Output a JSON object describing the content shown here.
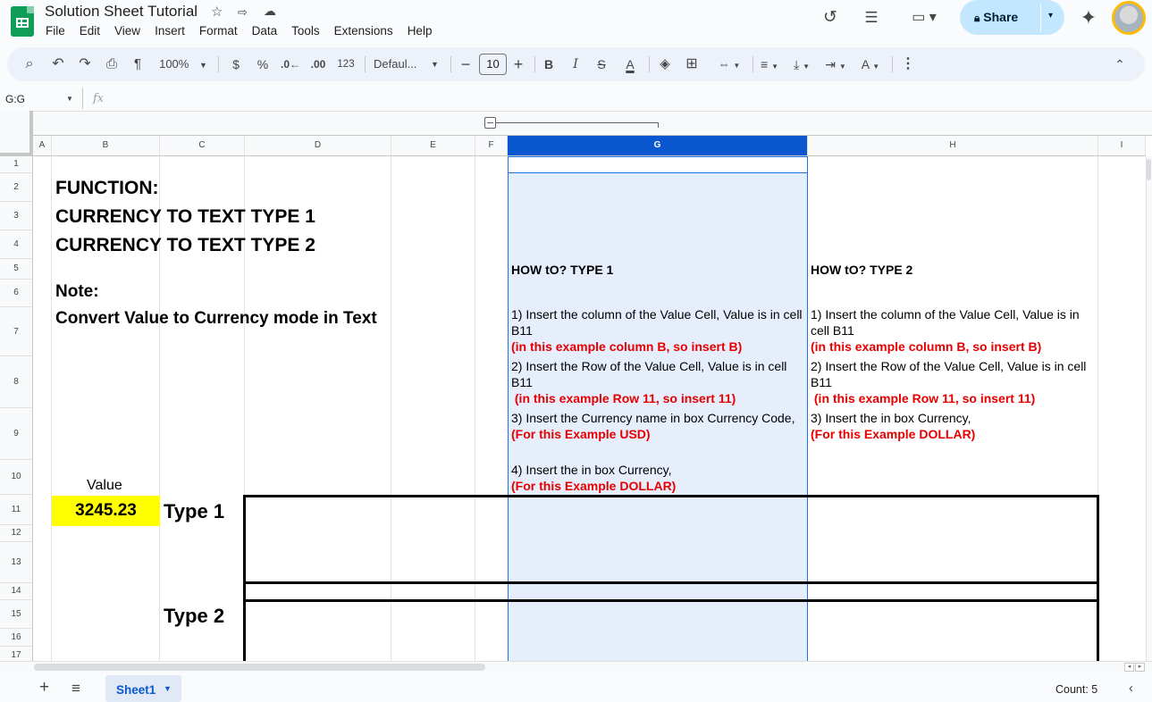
{
  "header": {
    "title": "Solution Sheet Tutorial",
    "menu": [
      "File",
      "Edit",
      "View",
      "Insert",
      "Format",
      "Data",
      "Tools",
      "Extensions",
      "Help"
    ],
    "share_label": "Share"
  },
  "toolbar": {
    "zoom": "100%",
    "currency": "$",
    "percent": "%",
    "dec_decrease": ".0←",
    "dec_increase": ".00",
    "format_123": "123",
    "font": "Defaul...",
    "font_size": "10",
    "bold": "B",
    "italic": "I",
    "text_color": "A"
  },
  "formula_bar": {
    "name_box": "G:G",
    "fx": "fx"
  },
  "columns": [
    "A",
    "B",
    "C",
    "D",
    "E",
    "F",
    "G",
    "H",
    "I"
  ],
  "rows": [
    "1",
    "2",
    "3",
    "4",
    "5",
    "6",
    "7",
    "8",
    "9",
    "10",
    "11",
    "12",
    "13",
    "14",
    "15",
    "16",
    "17"
  ],
  "cells": {
    "function_label": "FUNCTION:",
    "type1_title": "CURRENCY TO TEXT TYPE 1",
    "type2_title": "CURRENCY TO TEXT TYPE 2",
    "note_label": "Note:",
    "note_text": "Convert Value to Currency mode in Text",
    "howto_type1": "HOW tO? TYPE 1",
    "howto_type2": "HOW tO? TYPE 2",
    "g_steps": {
      "s1": "1) Insert the column of the Value Cell, Value is in cell B11",
      "s1_red": "(in this example column B, so insert B)",
      "s2": "2) Insert the Row of the Value Cell, Value is in cell B11",
      "s2_red": " (in this example Row 11, so insert 11)",
      "s3": "3) Insert the Currency name in box Currency Code,",
      "s3_red": "(For this Example USD)",
      "s4": "4) Insert the in box Currency,",
      "s4_red": "(For this Example DOLLAR)"
    },
    "h_steps": {
      "s1": "1) Insert the column of the Value Cell, Value is in cell B11",
      "s1_red": "(in this example column B, so insert B)",
      "s2": "2) Insert the Row of the Value Cell, Value is in cell B11",
      "s2_red": " (in this example Row 11, so insert 11)",
      "s3": "3) Insert the in box Currency,",
      "s3_red": "(For this Example DOLLAR)"
    },
    "value_label": "Value",
    "value": "3245.23",
    "type1_label": "Type 1",
    "type2_label": "Type 2"
  },
  "bottom": {
    "sheet_name": "Sheet1",
    "status": "Count: 5"
  },
  "colors": {
    "selection": "#0b57d0",
    "highlight_yellow": "#ffff00",
    "red_text": "#e60000",
    "share_bg": "#c2e7ff"
  }
}
